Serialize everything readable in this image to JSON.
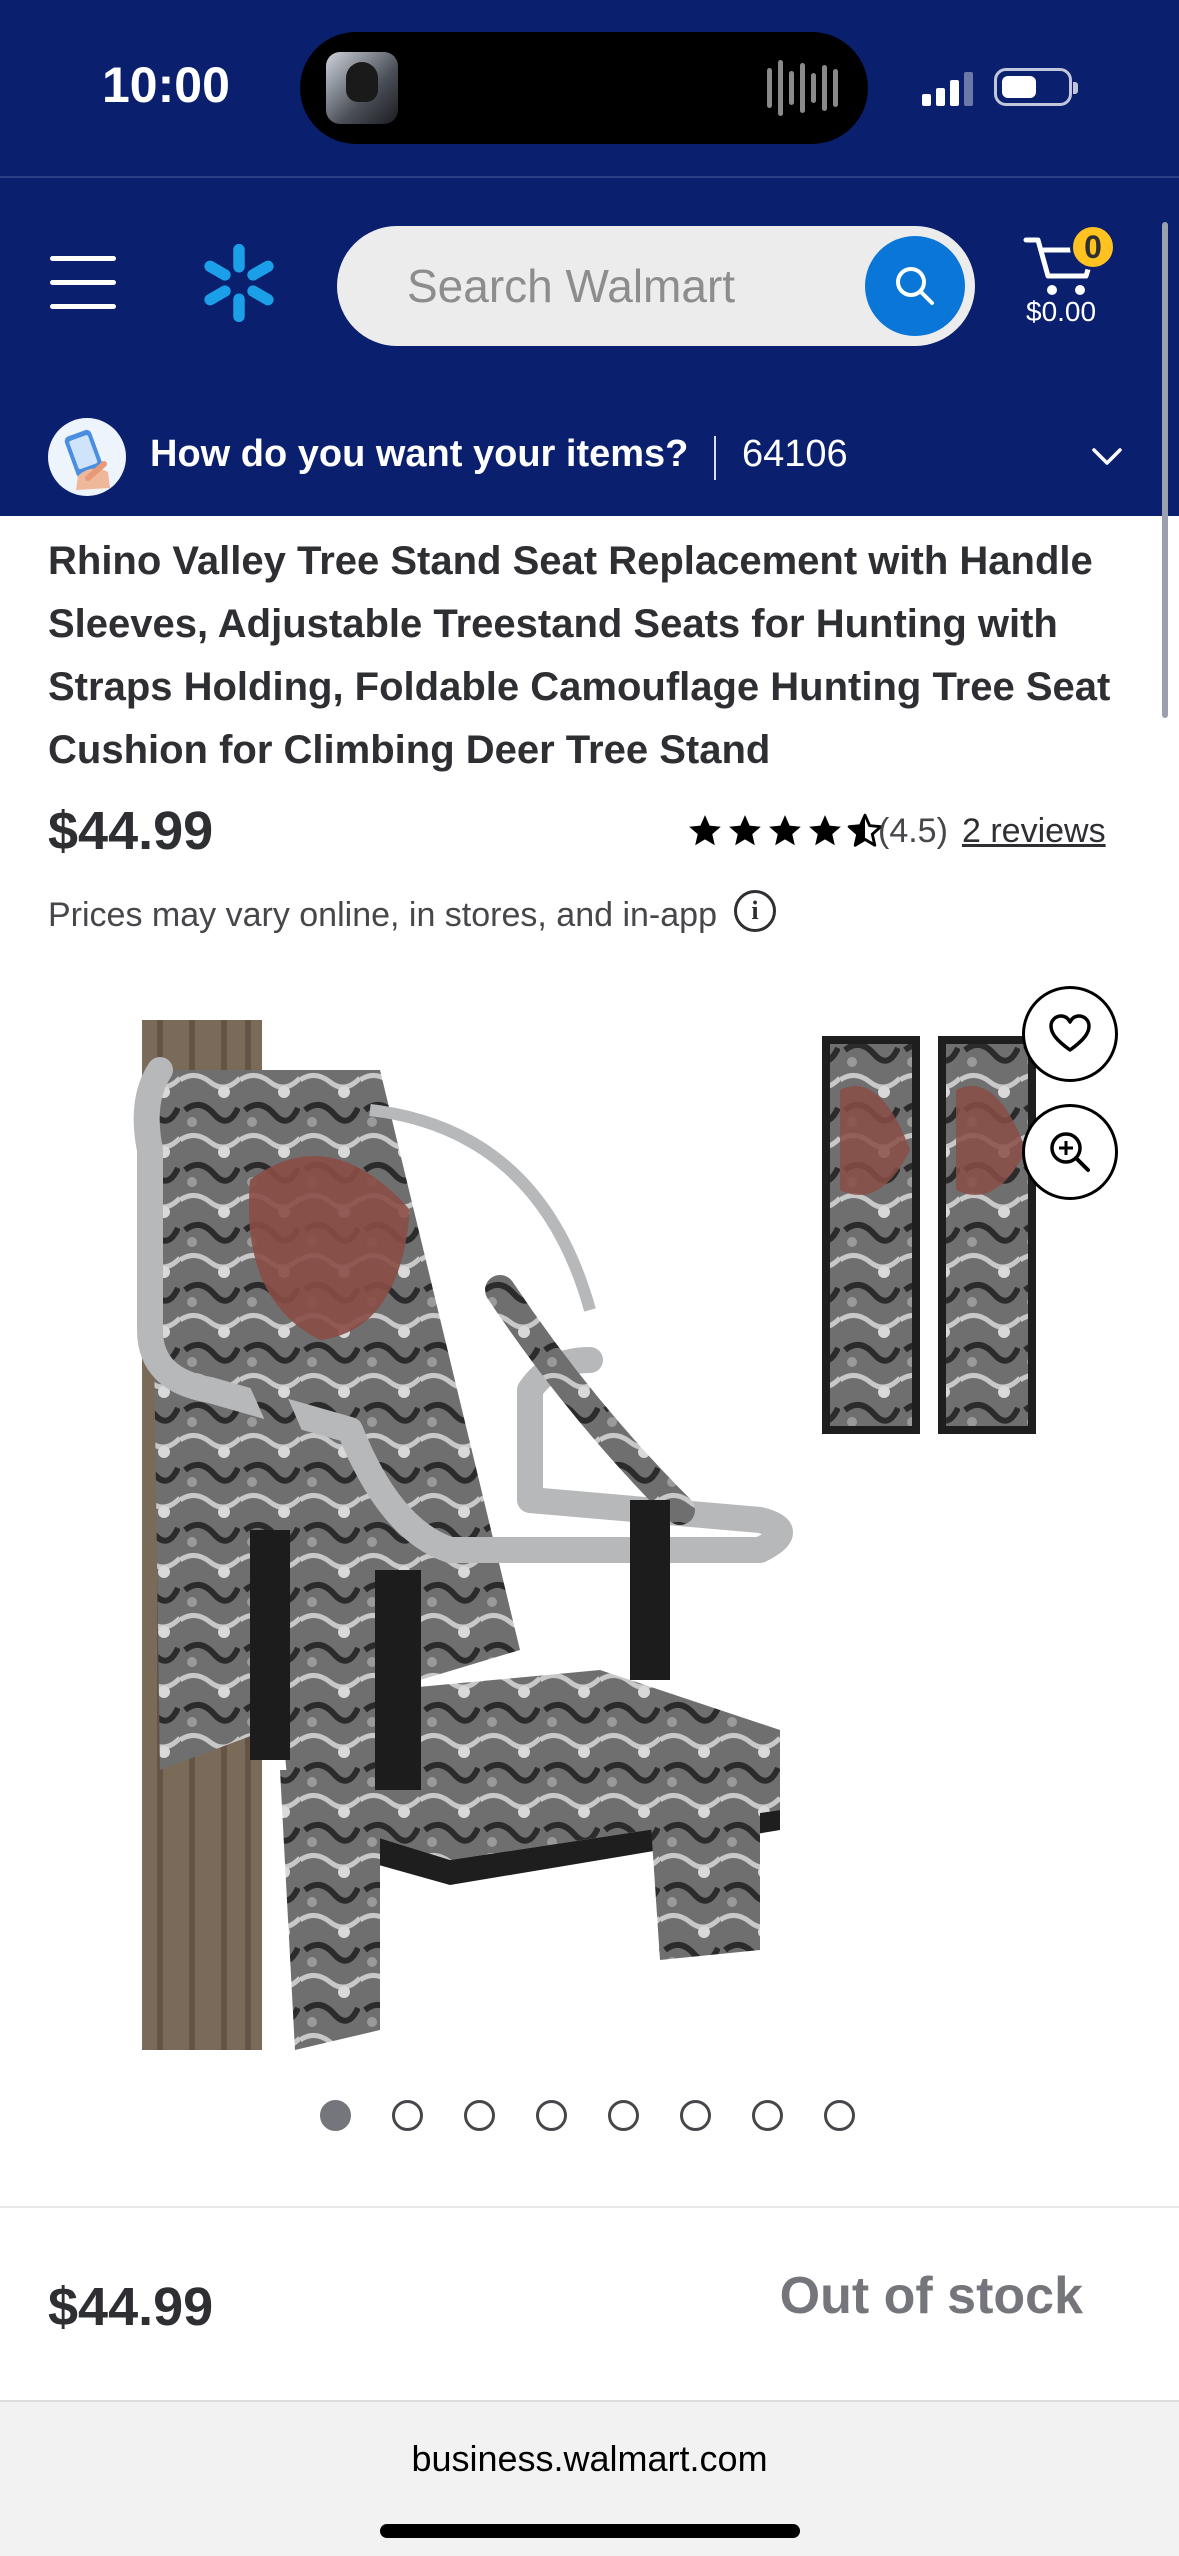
{
  "status_bar": {
    "time": "10:00"
  },
  "header": {
    "search_placeholder": "Search Walmart",
    "cart_count": "0",
    "cart_total": "$0.00"
  },
  "delivery": {
    "prompt": "How do you want your items?",
    "zip": "64106"
  },
  "product": {
    "title": "Rhino Valley Tree Stand Seat Replacement with Handle Sleeves, Adjustable Treestand Seats for Hunting with Straps Holding, Foldable Camouflage Hunting Tree Seat Cushion for Climbing Deer Tree Stand",
    "price": "$44.99",
    "rating": 4.5,
    "rating_text": "(4.5)",
    "reviews_label": "2 reviews",
    "price_note": "Prices may vary online, in stores, and in-app",
    "image_count": 8,
    "active_image": 1
  },
  "bottom_bar": {
    "price": "$44.99",
    "availability": "Out of stock"
  },
  "browser": {
    "url": "business.walmart.com"
  },
  "colors": {
    "brand_blue": "#0a1f6e",
    "search_blue": "#0a76d8",
    "badge_yellow": "#ffc220",
    "spark_blue": "#1a9fe8"
  }
}
